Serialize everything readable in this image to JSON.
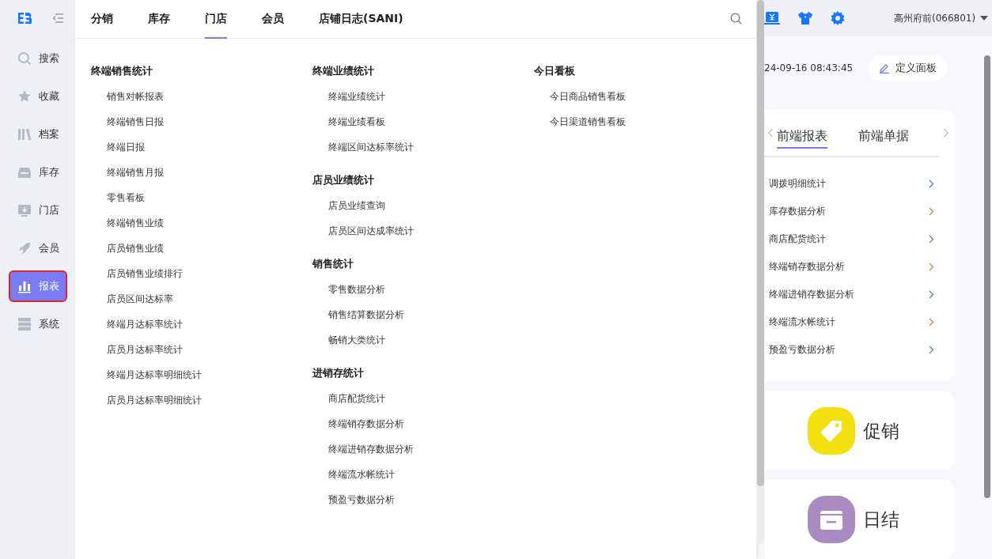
{
  "sidebar": {
    "items": [
      {
        "label": "搜索",
        "selected": false
      },
      {
        "label": "收藏",
        "selected": false
      },
      {
        "label": "档案",
        "selected": false
      },
      {
        "label": "库存",
        "selected": false
      },
      {
        "label": "门店",
        "selected": false
      },
      {
        "label": "会员",
        "selected": false
      },
      {
        "label": "报表",
        "selected": true
      },
      {
        "label": "系统",
        "selected": false
      }
    ]
  },
  "menu": {
    "tabs": [
      {
        "label": "分销",
        "selected": false
      },
      {
        "label": "库存",
        "selected": false
      },
      {
        "label": "门店",
        "selected": true
      },
      {
        "label": "会员",
        "selected": false
      },
      {
        "label": "店铺日志(SANI)",
        "selected": false
      }
    ],
    "columns": [
      [
        {
          "title": "终端销售统计",
          "items": [
            "销售对帐报表",
            "终端销售日报",
            "终端日报",
            "终端销售月报",
            "零售看板",
            "终端销售业绩",
            "店员销售业绩",
            "店员销售业绩排行",
            "店员区间达标率",
            "终端月达标率统计",
            "店员月达标率统计",
            "终端月达标率明细统计",
            "店员月达标率明细统计"
          ]
        }
      ],
      [
        {
          "title": "终端业绩统计",
          "items": [
            "终端业绩统计",
            "终端业绩看板",
            "终端区间达标率统计"
          ]
        },
        {
          "title": "店员业绩统计",
          "items": [
            "店员业绩查询",
            "店员区间达成率统计"
          ]
        },
        {
          "title": "销售统计",
          "items": [
            "零售数据分析",
            "销售结算数据分析",
            "畅销大类统计"
          ]
        },
        {
          "title": "进销存统计",
          "items": [
            "商店配货统计",
            "终端销存数据分析",
            "终端进销存数据分析",
            "终端流水帐统计",
            "预盈亏数据分析"
          ]
        }
      ],
      [
        {
          "title": "今日看板",
          "items": [
            "今日商品销售看板",
            "今日渠道销售看板"
          ]
        }
      ]
    ]
  },
  "header": {
    "store": "高州府前(066801)"
  },
  "dashboard": {
    "datetime": "24-09-16 08:43:45",
    "define_button": "定义面板",
    "tabs": [
      {
        "label": "前端报表",
        "selected": true
      },
      {
        "label": "前端单据",
        "selected": false
      }
    ],
    "reports": [
      "调拨明细统计",
      "库存数据分析",
      "商店配货统计",
      "终端销存数据分析",
      "终端进销存数据分析",
      "终端流水帐统计",
      "预盈亏数据分析"
    ],
    "tiles": [
      {
        "label": "促销",
        "color": "#f2e00f"
      },
      {
        "label": "日结",
        "color": "#a98bc2"
      }
    ]
  }
}
